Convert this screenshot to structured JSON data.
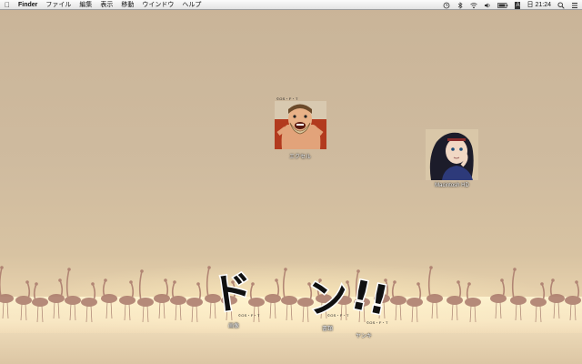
{
  "menubar": {
    "app_name": "Finder",
    "menus": [
      "ファイル",
      "編集",
      "表示",
      "移動",
      "ウインドウ",
      "ヘルプ"
    ],
    "status": {
      "input_method": "A",
      "day": "日",
      "time": "21:24"
    }
  },
  "desktop_icons": [
    {
      "label": "エクセル",
      "credit": "©OS・F・T",
      "icon": "bearded-character-icon"
    },
    {
      "label": "Macintosh HD",
      "credit": "",
      "icon": "dark-haired-character-icon"
    }
  ],
  "manga_text": {
    "characters": "ドン!!"
  },
  "bottom_icons": [
    {
      "label": "画像",
      "credit": "©OS・F・T"
    },
    {
      "label": "書類",
      "credit": "©OS・F・T"
    },
    {
      "label": "ヤンキ",
      "credit": "©OS・F・T"
    }
  ]
}
